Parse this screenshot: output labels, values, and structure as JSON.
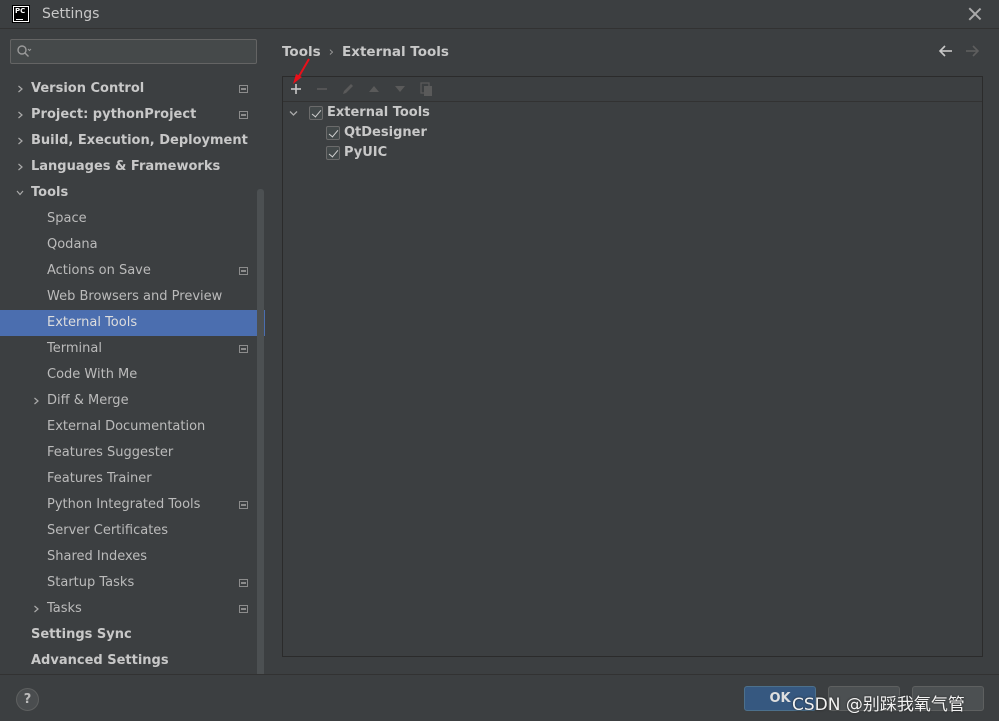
{
  "window": {
    "title": "Settings"
  },
  "search": {
    "value": "",
    "placeholder": ""
  },
  "sidebar": {
    "items": [
      {
        "label": "Version Control",
        "level": 0,
        "bold": true,
        "arrow": "right",
        "project_icon": true
      },
      {
        "label": "Project: pythonProject",
        "level": 0,
        "bold": true,
        "arrow": "right",
        "project_icon": true
      },
      {
        "label": "Build, Execution, Deployment",
        "level": 0,
        "bold": true,
        "arrow": "right",
        "project_icon": false
      },
      {
        "label": "Languages & Frameworks",
        "level": 0,
        "bold": true,
        "arrow": "right",
        "project_icon": false
      },
      {
        "label": "Tools",
        "level": 0,
        "bold": true,
        "arrow": "down",
        "project_icon": false
      },
      {
        "label": "Space",
        "level": 1,
        "bold": false,
        "arrow": "",
        "project_icon": false
      },
      {
        "label": "Qodana",
        "level": 1,
        "bold": false,
        "arrow": "",
        "project_icon": false
      },
      {
        "label": "Actions on Save",
        "level": 1,
        "bold": false,
        "arrow": "",
        "project_icon": true
      },
      {
        "label": "Web Browsers and Preview",
        "level": 1,
        "bold": false,
        "arrow": "",
        "project_icon": false
      },
      {
        "label": "External Tools",
        "level": 1,
        "bold": false,
        "arrow": "",
        "project_icon": false,
        "selected": true
      },
      {
        "label": "Terminal",
        "level": 1,
        "bold": false,
        "arrow": "",
        "project_icon": true
      },
      {
        "label": "Code With Me",
        "level": 1,
        "bold": false,
        "arrow": "",
        "project_icon": false
      },
      {
        "label": "Diff & Merge",
        "level": 1,
        "bold": false,
        "arrow": "right",
        "project_icon": false
      },
      {
        "label": "External Documentation",
        "level": 1,
        "bold": false,
        "arrow": "",
        "project_icon": false
      },
      {
        "label": "Features Suggester",
        "level": 1,
        "bold": false,
        "arrow": "",
        "project_icon": false
      },
      {
        "label": "Features Trainer",
        "level": 1,
        "bold": false,
        "arrow": "",
        "project_icon": false
      },
      {
        "label": "Python Integrated Tools",
        "level": 1,
        "bold": false,
        "arrow": "",
        "project_icon": true
      },
      {
        "label": "Server Certificates",
        "level": 1,
        "bold": false,
        "arrow": "",
        "project_icon": false
      },
      {
        "label": "Shared Indexes",
        "level": 1,
        "bold": false,
        "arrow": "",
        "project_icon": false
      },
      {
        "label": "Startup Tasks",
        "level": 1,
        "bold": false,
        "arrow": "",
        "project_icon": true
      },
      {
        "label": "Tasks",
        "level": 1,
        "bold": false,
        "arrow": "right",
        "project_icon": true
      },
      {
        "label": "Settings Sync",
        "level": 0,
        "bold": true,
        "arrow": "",
        "project_icon": false
      },
      {
        "label": "Advanced Settings",
        "level": 0,
        "bold": true,
        "arrow": "",
        "project_icon": false
      }
    ]
  },
  "breadcrumb": {
    "parent": "Tools",
    "separator": "›",
    "current": "External Tools"
  },
  "external_tools": {
    "group": {
      "label": "External Tools",
      "checked": true
    },
    "children": [
      {
        "label": "QtDesigner",
        "checked": true
      },
      {
        "label": "PyUIC",
        "checked": true
      }
    ]
  },
  "buttons": {
    "help": "?",
    "ok": "OK"
  },
  "watermark": "CSDN @别踩我氧气管",
  "colors": {
    "accent": "#4b6eaf",
    "background": "#3c3f41",
    "ok_button": "#365880",
    "annotation_arrow": "#e8101a"
  }
}
